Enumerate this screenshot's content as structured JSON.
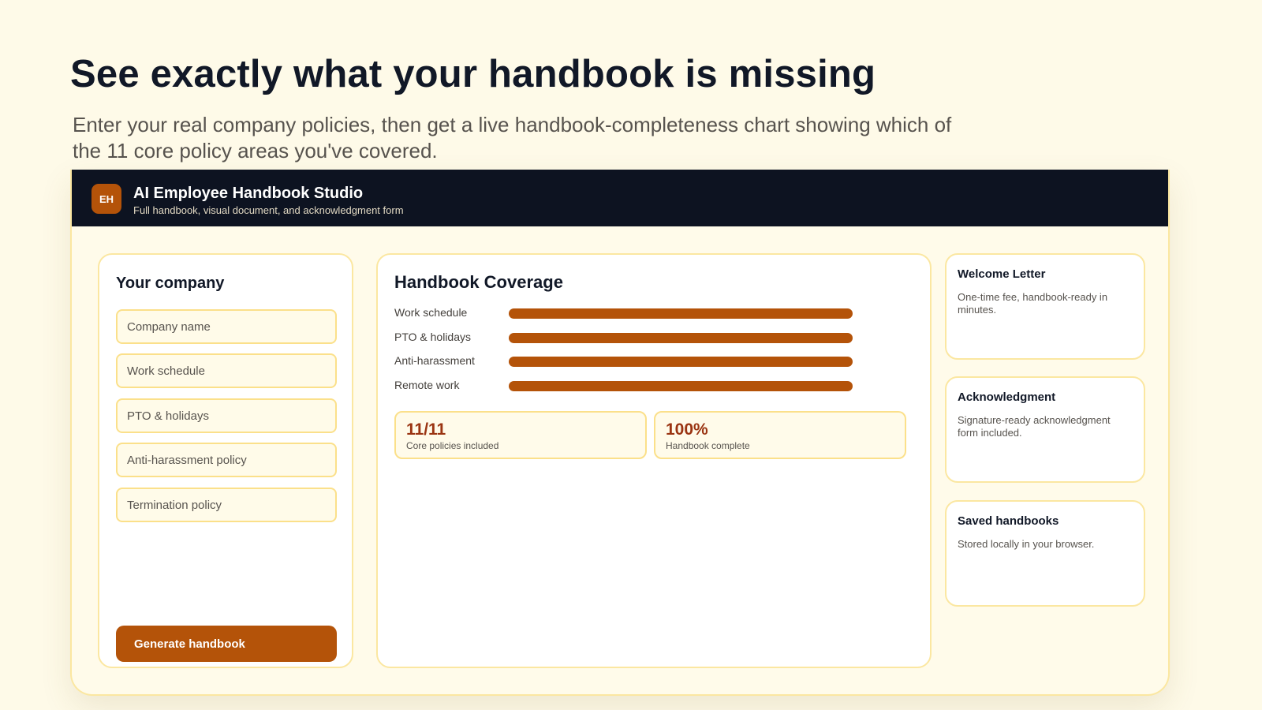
{
  "page": {
    "headline": "See exactly what your handbook is missing",
    "subhead": "Enter your real company policies, then get a live handbook-completeness chart showing which of the 11 core policy areas you've covered."
  },
  "app": {
    "logo": "EH",
    "title": "AI Employee Handbook Studio",
    "subtitle": "Full handbook, visual document, and acknowledgment form"
  },
  "company_form": {
    "heading": "Your company",
    "fields": [
      {
        "placeholder": "Company name",
        "value": ""
      },
      {
        "placeholder": "Work schedule",
        "value": ""
      },
      {
        "placeholder": "PTO & holidays",
        "value": ""
      },
      {
        "placeholder": "Anti-harassment policy",
        "value": ""
      },
      {
        "placeholder": "Termination policy",
        "value": ""
      }
    ],
    "generate_label": "Generate handbook"
  },
  "coverage": {
    "title": "Handbook Coverage",
    "bar_color": "#b45309",
    "stats": [
      {
        "value": "11/11",
        "label": "Core policies included"
      },
      {
        "value": "100%",
        "label": "Handbook complete"
      }
    ]
  },
  "chart_data": {
    "type": "bar",
    "orientation": "horizontal",
    "title": "Handbook Coverage",
    "categories": [
      "Work schedule",
      "PTO & holidays",
      "Anti-harassment",
      "Remote work"
    ],
    "values": [
      100,
      100,
      100,
      100
    ],
    "xlim": [
      0,
      100
    ]
  },
  "side_cards": [
    {
      "title": "Welcome Letter",
      "description": "One-time fee, handbook-ready in minutes."
    },
    {
      "title": "Acknowledgment",
      "description": "Signature-ready acknowledgment form included."
    },
    {
      "title": "Saved handbooks",
      "description": "Stored locally in your browser."
    }
  ],
  "colors": {
    "accent": "#b45309",
    "titlebar": "#0d1321",
    "page_background": "#fefae8",
    "border": "#fbe7a1"
  }
}
